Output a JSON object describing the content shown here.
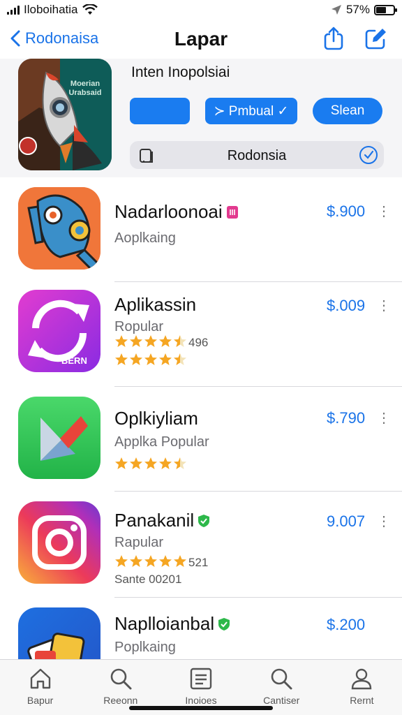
{
  "status_bar": {
    "carrier": "Iloboihatia",
    "battery": "57%",
    "battery_level": 0.57
  },
  "header": {
    "back_label": "Rodonaisa",
    "title": "Lapar"
  },
  "featured": {
    "title": "Inten Inopolsiai",
    "art_text": "Moerian Urabsaid",
    "buttons": [
      "",
      "≻ Pmbual ✓",
      "Slean"
    ],
    "search_text": "Rodonsia"
  },
  "apps": [
    {
      "name": "Nadarloonoai",
      "subtitle": "Aoplkaing",
      "price": "$.900"
    },
    {
      "name": "Aplikassin",
      "subtitle": "Ropular",
      "price": "$.009",
      "rating_count": "496",
      "icon_text": "BERN"
    },
    {
      "name": "Oplkiyliam",
      "subtitle": "Applka Popular",
      "price": "$.790"
    },
    {
      "name": "Panakanil",
      "subtitle": "Rapular",
      "price": "9.007",
      "rating_count": "521",
      "extra": "Sante 00201"
    },
    {
      "name": "Naplloianbal",
      "subtitle": "Poplkaing",
      "price": "$.200"
    }
  ],
  "tabs": [
    {
      "label": "Bapur",
      "icon": "home-icon"
    },
    {
      "label": "Reeonn",
      "icon": "search-icon"
    },
    {
      "label": "Inoioes",
      "icon": "list-icon"
    },
    {
      "label": "Cantiser",
      "icon": "search-icon"
    },
    {
      "label": "Rernt",
      "icon": "person-icon"
    }
  ],
  "colors": {
    "accent": "#1a7cf0",
    "link": "#1a73e8",
    "star": "#f5a623"
  }
}
